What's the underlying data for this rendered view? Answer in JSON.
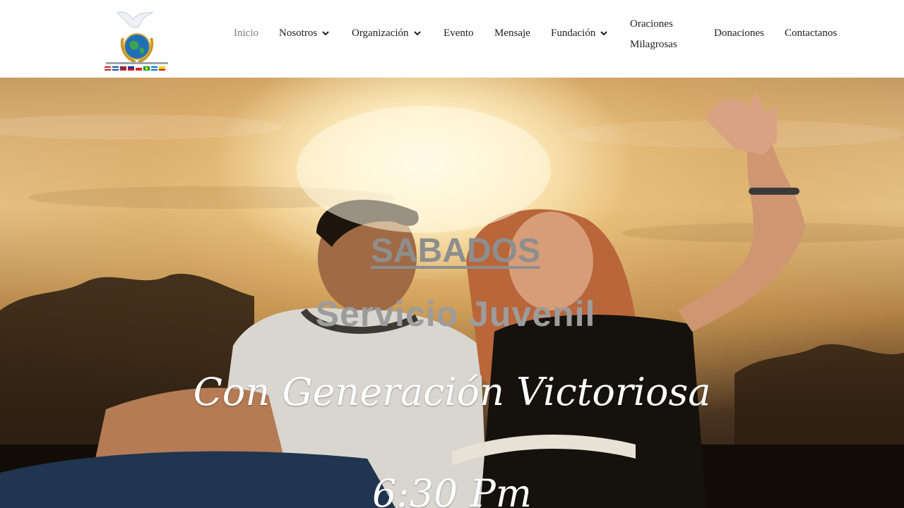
{
  "nav": {
    "items": [
      {
        "label": "Inicio",
        "active": true,
        "dropdown": false
      },
      {
        "label": "Nosotros",
        "active": false,
        "dropdown": true
      },
      {
        "label": "Organización",
        "active": false,
        "dropdown": true
      },
      {
        "label": "Evento",
        "active": false,
        "dropdown": false
      },
      {
        "label": "Mensaje",
        "active": false,
        "dropdown": false
      },
      {
        "label": "Fundación",
        "active": false,
        "dropdown": true
      },
      {
        "label_line1": "Oraciones",
        "label_line2": "Milagrosas",
        "active": false,
        "dropdown": false
      },
      {
        "label": "Donaciones",
        "active": false,
        "dropdown": false
      },
      {
        "label": "Contactanos",
        "active": false,
        "dropdown": false
      }
    ]
  },
  "logo": {
    "icon": "dove-globe-emblem-icon"
  },
  "hero": {
    "day": "SABADOS",
    "service": "Servicio Juvenil",
    "group": "Con Generación Victoriosa",
    "time": "6:30 Pm"
  },
  "colors": {
    "nav_text": "#1c1c1c",
    "nav_active": "#7a7a7a",
    "day_text": "#8e8e8e",
    "service_text": "#9c9c9c",
    "headline_text": "#ffffff"
  }
}
